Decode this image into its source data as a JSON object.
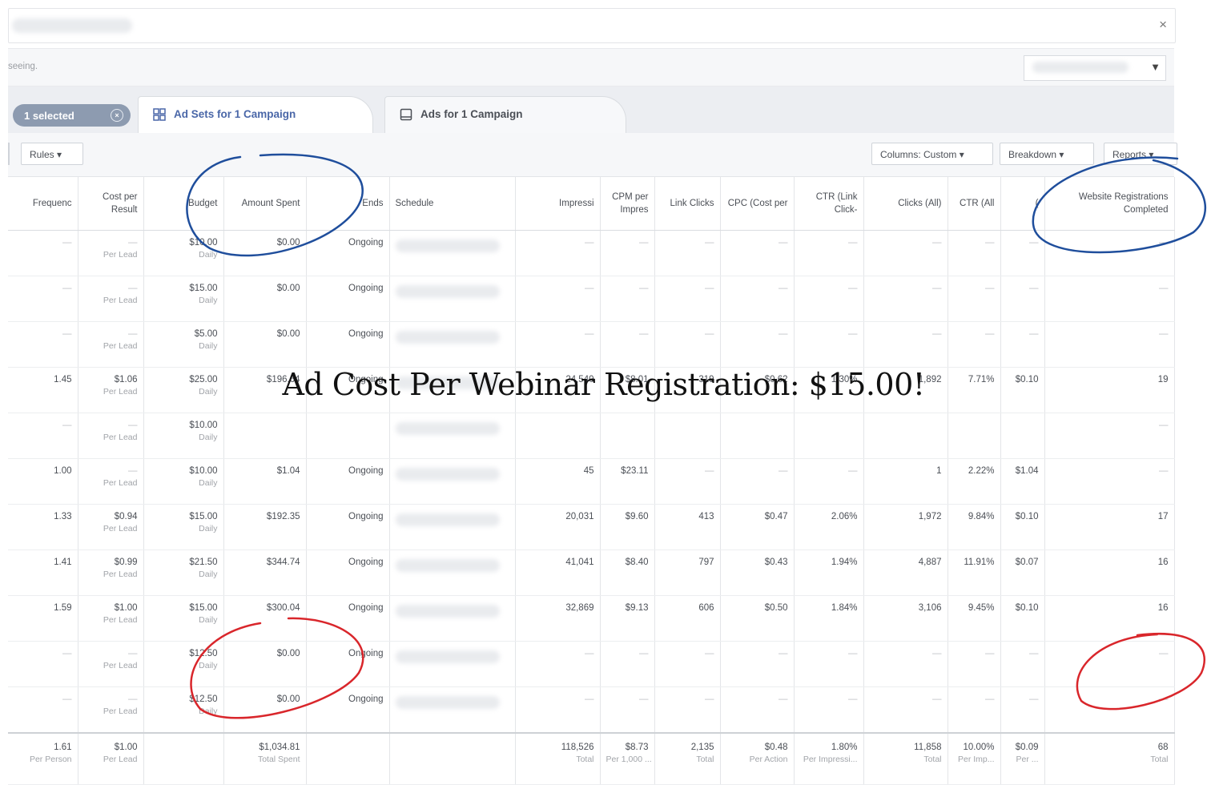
{
  "topbar": {
    "close_label": "×"
  },
  "infobar": {
    "text": "seeing."
  },
  "tabs": {
    "selected_label": "1 selected",
    "selected_clear": "×",
    "active_label": "Ad Sets for 1 Campaign",
    "inactive_label": "Ads for 1 Campaign"
  },
  "toolbar": {
    "rules_label": "Rules ▾",
    "columns_label": "Columns: Custom ▾",
    "breakdown_label": "Breakdown ▾",
    "reports_label": "Reports ▾"
  },
  "headline": "Ad Cost Per Webinar Registration: $15.00!",
  "table": {
    "headers": [
      "Frequenc",
      "Cost per Result",
      "Budget",
      "Amount Spent",
      "Ends",
      "Schedule",
      "Impressi",
      "CPM per Impres",
      "Link Clicks",
      "CPC (Cost per",
      "CTR (Link Click-",
      "Clicks (All)",
      "CTR (All",
      "(",
      "Website Registrations Completed"
    ],
    "rows": [
      {
        "freq": "—",
        "cost": "—",
        "cost_sub": "Per Lead",
        "budget": "$10.00",
        "budget_sub": "Daily",
        "spent": "$0.00",
        "ends": "Ongoing",
        "impr": "—",
        "cpm": "—",
        "link": "—",
        "cpc": "—",
        "ctr": "—",
        "clicks": "—",
        "ctra": "—",
        "cpca": "—",
        "reg": "—"
      },
      {
        "freq": "—",
        "cost": "—",
        "cost_sub": "Per Lead",
        "budget": "$15.00",
        "budget_sub": "Daily",
        "spent": "$0.00",
        "ends": "Ongoing",
        "impr": "—",
        "cpm": "—",
        "link": "—",
        "cpc": "—",
        "ctr": "—",
        "clicks": "—",
        "ctra": "—",
        "cpca": "—",
        "reg": "—"
      },
      {
        "freq": "—",
        "cost": "—",
        "cost_sub": "Per Lead",
        "budget": "$5.00",
        "budget_sub": "Daily",
        "spent": "$0.00",
        "ends": "Ongoing",
        "impr": "—",
        "cpm": "—",
        "link": "—",
        "cpc": "—",
        "ctr": "—",
        "clicks": "—",
        "ctra": "—",
        "cpca": "—",
        "reg": "—"
      },
      {
        "freq": "1.45",
        "cost": "$1.06",
        "cost_sub": "Per Lead",
        "budget": "$25.00",
        "budget_sub": "Daily",
        "spent": "$196.64",
        "ends": "Ongoing",
        "impr": "24,540",
        "cpm": "$8.01",
        "link": "319",
        "cpc": "$0.62",
        "ctr": "1.30%",
        "clicks": "1,892",
        "ctra": "7.71%",
        "cpca": "$0.10",
        "reg": "19"
      },
      {
        "freq": "—",
        "cost": "—",
        "cost_sub": "Per Lead",
        "budget": "$10.00",
        "budget_sub": "Daily",
        "spent": "",
        "ends": "",
        "impr": "",
        "cpm": "",
        "link": "",
        "cpc": "",
        "ctr": "",
        "clicks": "",
        "ctra": "",
        "cpca": "",
        "reg": "—"
      },
      {
        "freq": "1.00",
        "cost": "—",
        "cost_sub": "Per Lead",
        "budget": "$10.00",
        "budget_sub": "Daily",
        "spent": "$1.04",
        "ends": "Ongoing",
        "impr": "45",
        "cpm": "$23.11",
        "link": "—",
        "cpc": "—",
        "ctr": "—",
        "clicks": "1",
        "ctra": "2.22%",
        "cpca": "$1.04",
        "reg": "—"
      },
      {
        "freq": "1.33",
        "cost": "$0.94",
        "cost_sub": "Per Lead",
        "budget": "$15.00",
        "budget_sub": "Daily",
        "spent": "$192.35",
        "ends": "Ongoing",
        "impr": "20,031",
        "cpm": "$9.60",
        "link": "413",
        "cpc": "$0.47",
        "ctr": "2.06%",
        "clicks": "1,972",
        "ctra": "9.84%",
        "cpca": "$0.10",
        "reg": "17"
      },
      {
        "freq": "1.41",
        "cost": "$0.99",
        "cost_sub": "Per Lead",
        "budget": "$21.50",
        "budget_sub": "Daily",
        "spent": "$344.74",
        "ends": "Ongoing",
        "impr": "41,041",
        "cpm": "$8.40",
        "link": "797",
        "cpc": "$0.43",
        "ctr": "1.94%",
        "clicks": "4,887",
        "ctra": "11.91%",
        "cpca": "$0.07",
        "reg": "16"
      },
      {
        "freq": "1.59",
        "cost": "$1.00",
        "cost_sub": "Per Lead",
        "budget": "$15.00",
        "budget_sub": "Daily",
        "spent": "$300.04",
        "ends": "Ongoing",
        "impr": "32,869",
        "cpm": "$9.13",
        "link": "606",
        "cpc": "$0.50",
        "ctr": "1.84%",
        "clicks": "3,106",
        "ctra": "9.45%",
        "cpca": "$0.10",
        "reg": "16"
      },
      {
        "freq": "—",
        "cost": "—",
        "cost_sub": "Per Lead",
        "budget": "$12.50",
        "budget_sub": "Daily",
        "spent": "$0.00",
        "ends": "Ongoing",
        "impr": "—",
        "cpm": "—",
        "link": "—",
        "cpc": "—",
        "ctr": "—",
        "clicks": "—",
        "ctra": "—",
        "cpca": "—",
        "reg": "—"
      },
      {
        "freq": "—",
        "cost": "—",
        "cost_sub": "Per Lead",
        "budget": "$12.50",
        "budget_sub": "Daily",
        "spent": "$0.00",
        "ends": "Ongoing",
        "impr": "—",
        "cpm": "—",
        "link": "—",
        "cpc": "—",
        "ctr": "—",
        "clicks": "—",
        "ctra": "—",
        "cpca": "—",
        "reg": "—"
      }
    ],
    "total": {
      "freq": "1.61",
      "freq_sub": "Per Person",
      "cost": "$1.00",
      "cost_sub": "Per Lead",
      "spent": "$1,034.81",
      "spent_sub": "Total Spent",
      "impr": "118,526",
      "impr_sub": "Total",
      "cpm": "$8.73",
      "cpm_sub": "Per 1,000 ...",
      "link": "2,135",
      "link_sub": "Total",
      "cpc": "$0.48",
      "cpc_sub": "Per Action",
      "ctr": "1.80%",
      "ctr_sub": "Per Impressi...",
      "clicks": "11,858",
      "clicks_sub": "Total",
      "ctra": "10.00%",
      "ctra_sub": "Per Imp...",
      "cpca": "$0.09",
      "cpca_sub": "Per ...",
      "reg": "68",
      "reg_sub": "Total"
    }
  },
  "annotation_colors": {
    "blue": "#1f4e9c",
    "red": "#d9262b"
  }
}
